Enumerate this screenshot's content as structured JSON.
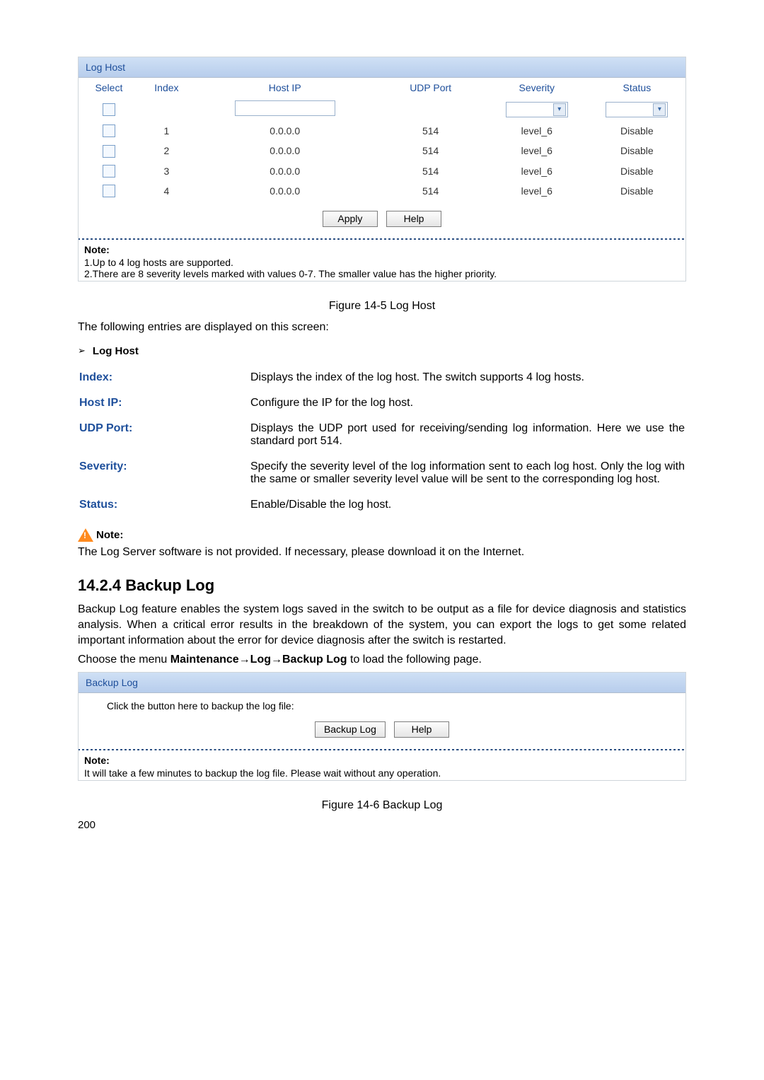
{
  "log_host_panel": {
    "title": "Log Host",
    "headers": [
      "Select",
      "Index",
      "Host IP",
      "UDP Port",
      "Severity",
      "Status"
    ],
    "rows": [
      {
        "index": "1",
        "host_ip": "0.0.0.0",
        "udp_port": "514",
        "severity": "level_6",
        "status": "Disable"
      },
      {
        "index": "2",
        "host_ip": "0.0.0.0",
        "udp_port": "514",
        "severity": "level_6",
        "status": "Disable"
      },
      {
        "index": "3",
        "host_ip": "0.0.0.0",
        "udp_port": "514",
        "severity": "level_6",
        "status": "Disable"
      },
      {
        "index": "4",
        "host_ip": "0.0.0.0",
        "udp_port": "514",
        "severity": "level_6",
        "status": "Disable"
      }
    ],
    "btn_apply": "Apply",
    "btn_help": "Help",
    "note_heading": "Note:",
    "note_1": "1.Up to 4 log hosts are supported.",
    "note_2": "2.There are 8 severity levels marked with values 0-7. The smaller value has the higher priority."
  },
  "figure1_caption": "Figure 14-5 Log Host",
  "intro_line": "The following entries are displayed on this screen:",
  "section_label": "Log Host",
  "definitions": {
    "index": {
      "term": "Index:",
      "desc": "Displays the index of the log host. The switch supports 4 log hosts."
    },
    "host_ip": {
      "term": "Host IP:",
      "desc": "Configure the IP for the log host."
    },
    "udp_port": {
      "term": "UDP Port:",
      "desc": "Displays the UDP port used for receiving/sending log information. Here we use the standard port 514."
    },
    "severity": {
      "term": "Severity:",
      "desc": "Specify the severity level of the log information sent to each log host. Only the log with the same or smaller severity level value will be sent to the corresponding log host."
    },
    "status": {
      "term": "Status:",
      "desc": "Enable/Disable the log host."
    }
  },
  "warn_label": "Note:",
  "warn_text": "The Log Server software is not provided. If necessary, please download it on the Internet.",
  "section_heading": "14.2.4  Backup Log",
  "backup_paragraph": "Backup Log feature enables the system logs saved in the switch to be output as a file for device diagnosis and statistics analysis. When a critical error results in the breakdown of the system, you can export the logs to get some related important information about the error for device diagnosis after the switch is restarted.",
  "menu_line_prefix": "Choose the menu ",
  "menu_line_bold": "Maintenance→Log→Backup Log",
  "menu_line_suffix": " to load the following page.",
  "backup_panel": {
    "title": "Backup Log",
    "instruction": "Click the button here to backup the log file:",
    "btn_backup": "Backup Log",
    "btn_help": "Help",
    "note_heading": "Note:",
    "note_text": "It will take a few minutes to backup the log file. Please wait without any operation."
  },
  "figure2_caption": "Figure 14-6 Backup Log",
  "page_number": "200"
}
